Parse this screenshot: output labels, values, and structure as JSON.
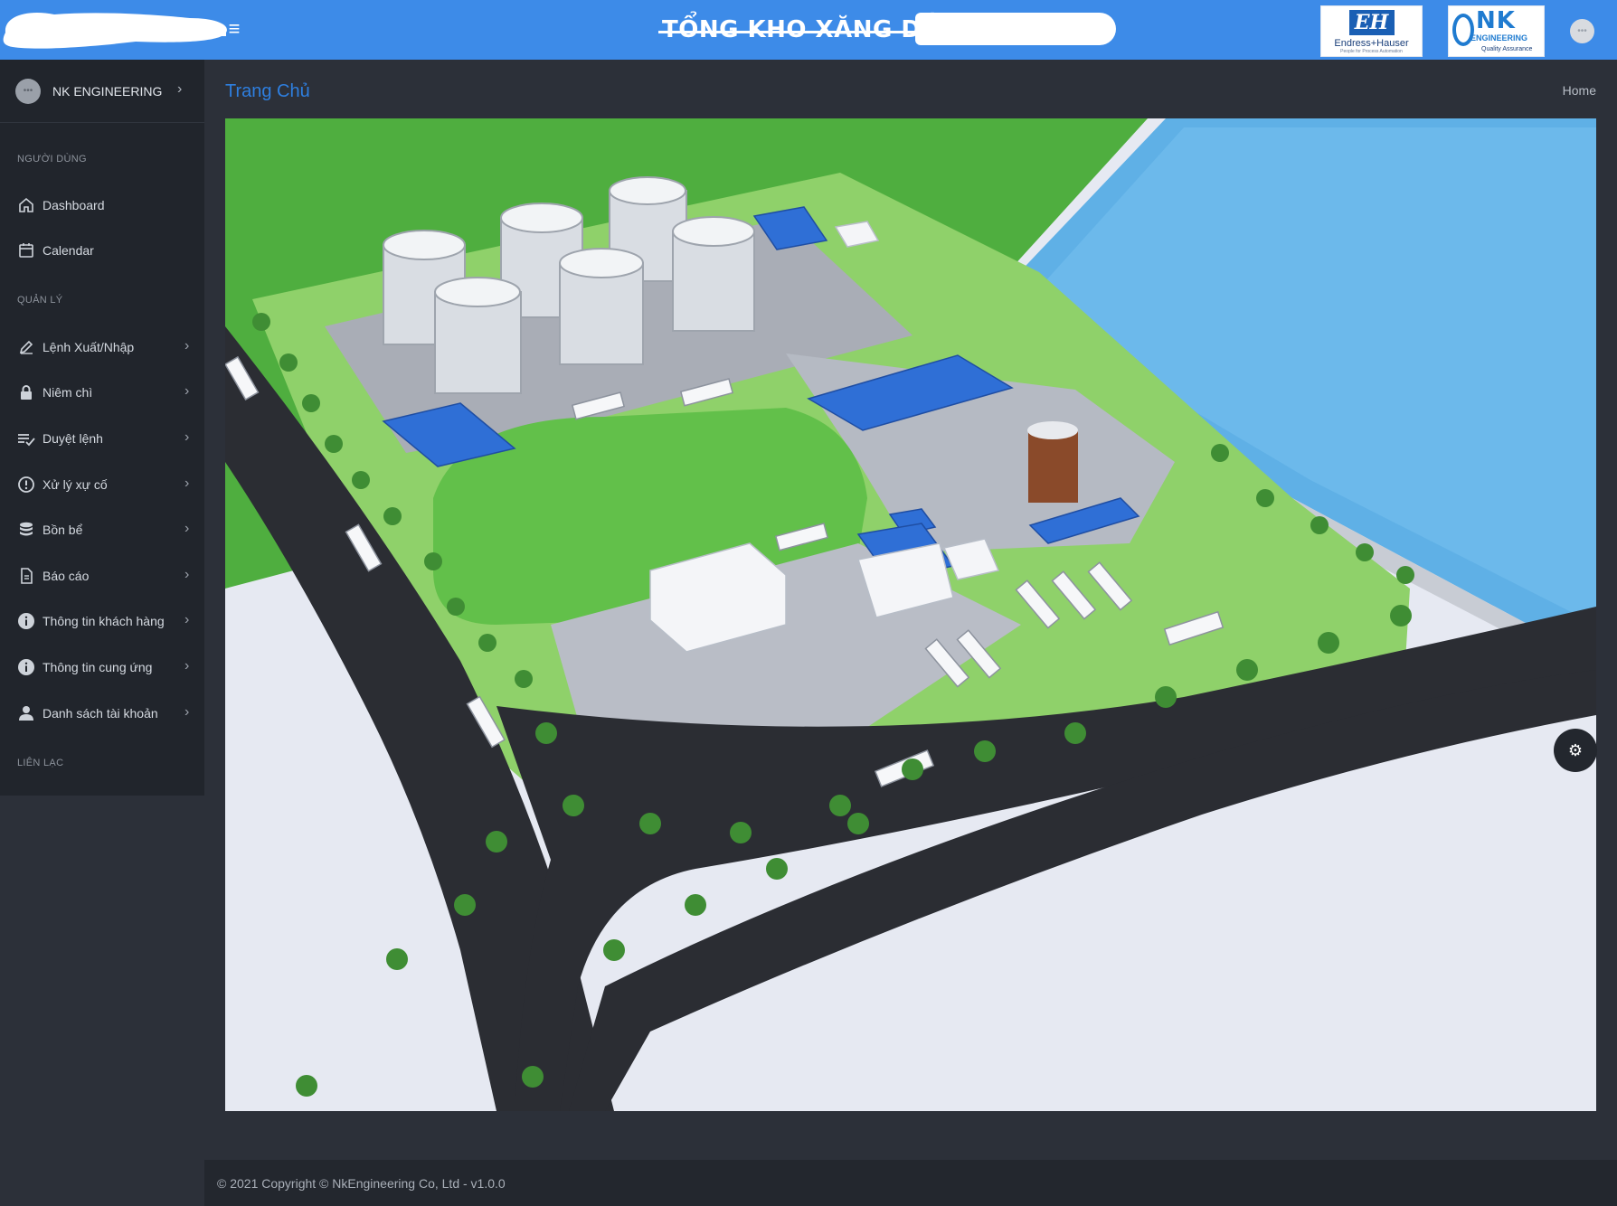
{
  "header": {
    "title": "TỔNG KHO XĂNG DẦ",
    "menu_icon": "hamburger-icon",
    "logos": {
      "endress_mark": "EH",
      "endress_name": "Endress+Hauser",
      "endress_tagline": "People for Process Automation",
      "nk_mark": "NK",
      "nk_name": "ENGINEERING",
      "nk_tagline": "Quality Assurance"
    },
    "user_avatar": "user-avatar-icon"
  },
  "sidebar": {
    "profile_name": "NK ENGINEERING",
    "sections": {
      "users": "NGƯỜI DÙNG",
      "management": "QUẢN LÝ",
      "contact": "LIÊN LẠC"
    },
    "user_items": [
      {
        "label": "Dashboard",
        "icon": "home-icon"
      },
      {
        "label": "Calendar",
        "icon": "calendar-icon"
      }
    ],
    "manage_items": [
      {
        "label": "Lệnh Xuất/Nhập",
        "icon": "pencil-icon"
      },
      {
        "label": "Niêm chì",
        "icon": "lock-icon"
      },
      {
        "label": "Duyệt lệnh",
        "icon": "checklist-icon"
      },
      {
        "label": "Xử lý xự cố",
        "icon": "alert-circle-icon"
      },
      {
        "label": "Bồn bể",
        "icon": "database-icon"
      },
      {
        "label": "Báo cáo",
        "icon": "document-icon"
      },
      {
        "label": "Thông tin khách hàng",
        "icon": "info-icon"
      },
      {
        "label": "Thông tin cung ứng",
        "icon": "info-icon"
      },
      {
        "label": "Danh sách tài khoản",
        "icon": "user-icon"
      }
    ]
  },
  "main": {
    "page_title": "Trang Chủ",
    "breadcrumb": "Home",
    "settings_icon": "gear-icon"
  },
  "footer": {
    "copyright": "© 2021 Copyright © NkEngineering Co, Ltd - v1.0.0"
  },
  "colors": {
    "header": "#3d8be8",
    "sidebar": "#21252c",
    "content": "#2c3039",
    "accent": "#2e7fe0"
  }
}
